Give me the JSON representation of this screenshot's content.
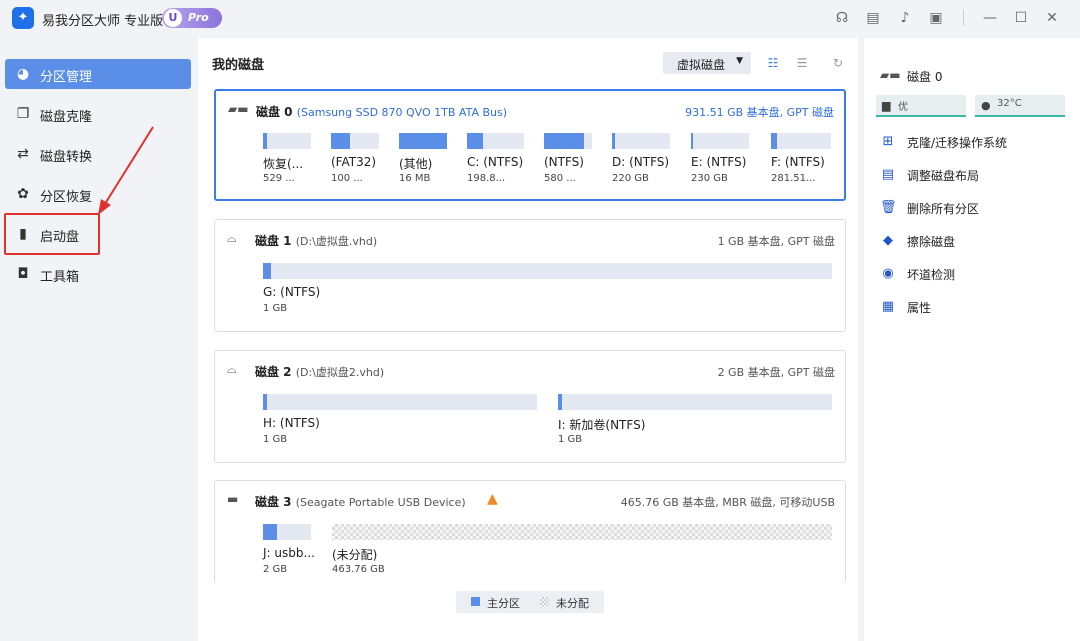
{
  "app": {
    "title": "易我分区大师 专业版",
    "badge_u": "U",
    "badge_pro": "Pro"
  },
  "titlebar_icons": [
    "headset-icon",
    "note-icon",
    "bell-icon",
    "minimize-to-tray-icon",
    "minimize-icon",
    "maximize-icon",
    "close-icon"
  ],
  "sidebar": {
    "items": [
      {
        "label": "分区管理",
        "icon": "pie-chart-icon",
        "active": true
      },
      {
        "label": "磁盘克隆",
        "icon": "copy-icon",
        "active": false
      },
      {
        "label": "磁盘转换",
        "icon": "convert-icon",
        "active": false
      },
      {
        "label": "分区恢复",
        "icon": "recover-icon",
        "active": false
      },
      {
        "label": "启动盘",
        "icon": "usb-icon",
        "active": false
      },
      {
        "label": "工具箱",
        "icon": "toolbox-icon",
        "active": false
      }
    ]
  },
  "main": {
    "title": "我的磁盘",
    "virtual_disk_button": "虚拟磁盘",
    "disks": [
      {
        "name": "磁盘 0",
        "desc": "(Samsung SSD 870 QVO 1TB ATA Bus)",
        "size": "931.51 GB 基本盘, GPT 磁盘",
        "partitions": [
          {
            "name": "恢复(...",
            "size": "529 ...",
            "fill": 0.08
          },
          {
            "name": "(FAT32)",
            "size": "100 ...",
            "fill": 0.4
          },
          {
            "name": "(其他)",
            "size": "16 MB",
            "fill": 1.0
          },
          {
            "name": "C: (NTFS)",
            "size": "198.8...",
            "fill": 0.28
          },
          {
            "name": "(NTFS)",
            "size": "580 ...",
            "fill": 1.0
          },
          {
            "name": "D: (NTFS)",
            "size": "220 GB",
            "fill": 0.05
          },
          {
            "name": "E: (NTFS)",
            "size": "230 GB",
            "fill": 0.04
          },
          {
            "name": "F: (NTFS)",
            "size": "281.51...",
            "fill": 0.1
          }
        ]
      },
      {
        "name": "磁盘 1",
        "desc": "(D:\\虚拟盘.vhd)",
        "size": "1 GB 基本盘, GPT 磁盘",
        "partitions": [
          {
            "name": "G: (NTFS)",
            "size": "1 GB",
            "fill": 0.01
          }
        ]
      },
      {
        "name": "磁盘 2",
        "desc": "(D:\\虚拟盘2.vhd)",
        "size": "2 GB 基本盘, GPT 磁盘",
        "partitions": [
          {
            "name": "H: (NTFS)",
            "size": "1 GB",
            "fill": 0.01
          },
          {
            "name": "I: 新加卷(NTFS)",
            "size": "1 GB",
            "fill": 0.01
          }
        ]
      },
      {
        "name": "磁盘 3",
        "desc": "(Seagate  Portable      USB Device)",
        "size": "465.76 GB 基本盘, MBR 磁盘, 可移动USB",
        "partitions": [
          {
            "name": "J: usbb...",
            "size": "2 GB",
            "fill": 0.3
          },
          {
            "name": "(未分配)",
            "size": "463.76 GB",
            "fill": 0
          }
        ]
      }
    ],
    "legend": {
      "primary": "主分区",
      "unallocated": "未分配"
    }
  },
  "right_panel": {
    "disk_title": "磁盘 0",
    "health": "优",
    "temperature": "32°C",
    "operations": [
      {
        "label": "克隆/迁移操作系统",
        "icon": "windows-icon"
      },
      {
        "label": "调整磁盘布局",
        "icon": "layout-icon"
      },
      {
        "label": "删除所有分区",
        "icon": "trash-icon"
      },
      {
        "label": "擦除磁盘",
        "icon": "eraser-icon"
      },
      {
        "label": "坏道检测",
        "icon": "scan-icon"
      },
      {
        "label": "属性",
        "icon": "properties-icon"
      }
    ]
  },
  "colors": {
    "accent": "#5b8ee6",
    "selected_border": "#3a7de8",
    "highlight": "#e0312f",
    "warning": "#f08a24"
  }
}
